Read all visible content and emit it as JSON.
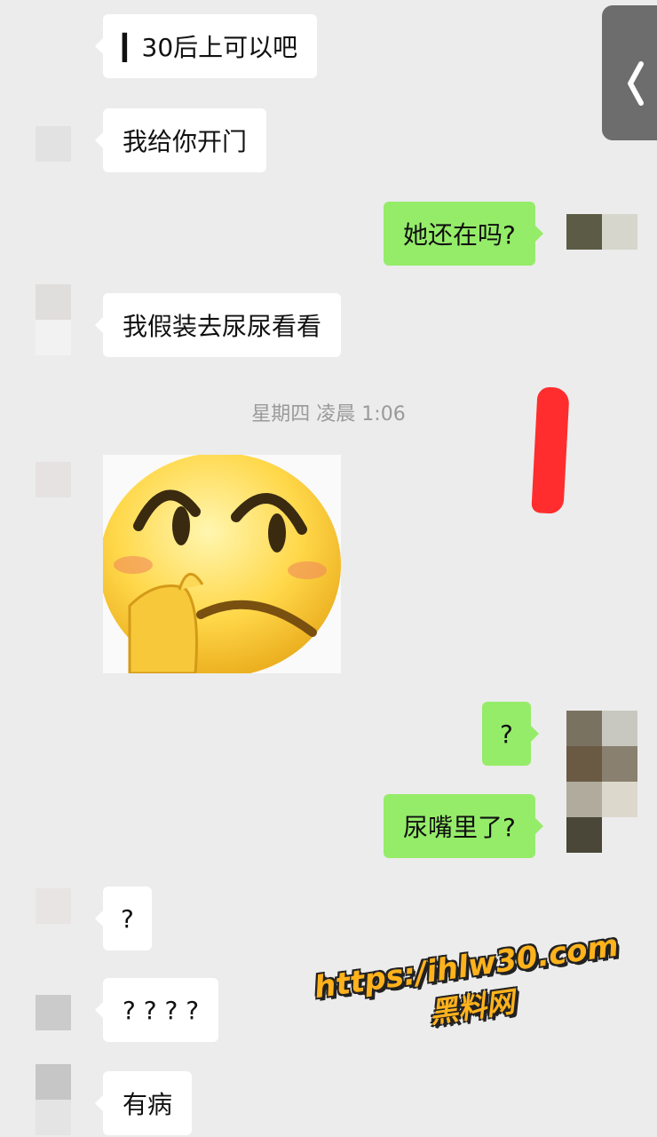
{
  "messages": {
    "m1": "▎30后上可以吧",
    "m2": "我给你开门",
    "m3": "她还在吗?",
    "m4": "我假装去尿尿看看",
    "m5": "?",
    "m6": "尿嘴里了?",
    "m7": "?",
    "m8": "? ? ? ?",
    "m9": "有病"
  },
  "timestamp": "星期四 凌晨 1:06",
  "sticker": {
    "caption": "表情包"
  },
  "watermark": {
    "url": "https:/ihlw30.com",
    "name": "黑料网"
  },
  "colors": {
    "background": "#ececec",
    "incoming_bubble": "#ffffff",
    "outgoing_bubble": "#95ec69",
    "timestamp_text": "#9a9a9a",
    "watermark": "#ffb21c",
    "red_mark": "#ff2d2d"
  },
  "icons": {
    "back": "chevron-left-icon",
    "avatars": "pixelated-avatar-icon",
    "sticker": "embarrassed-face-emoji-icon"
  }
}
